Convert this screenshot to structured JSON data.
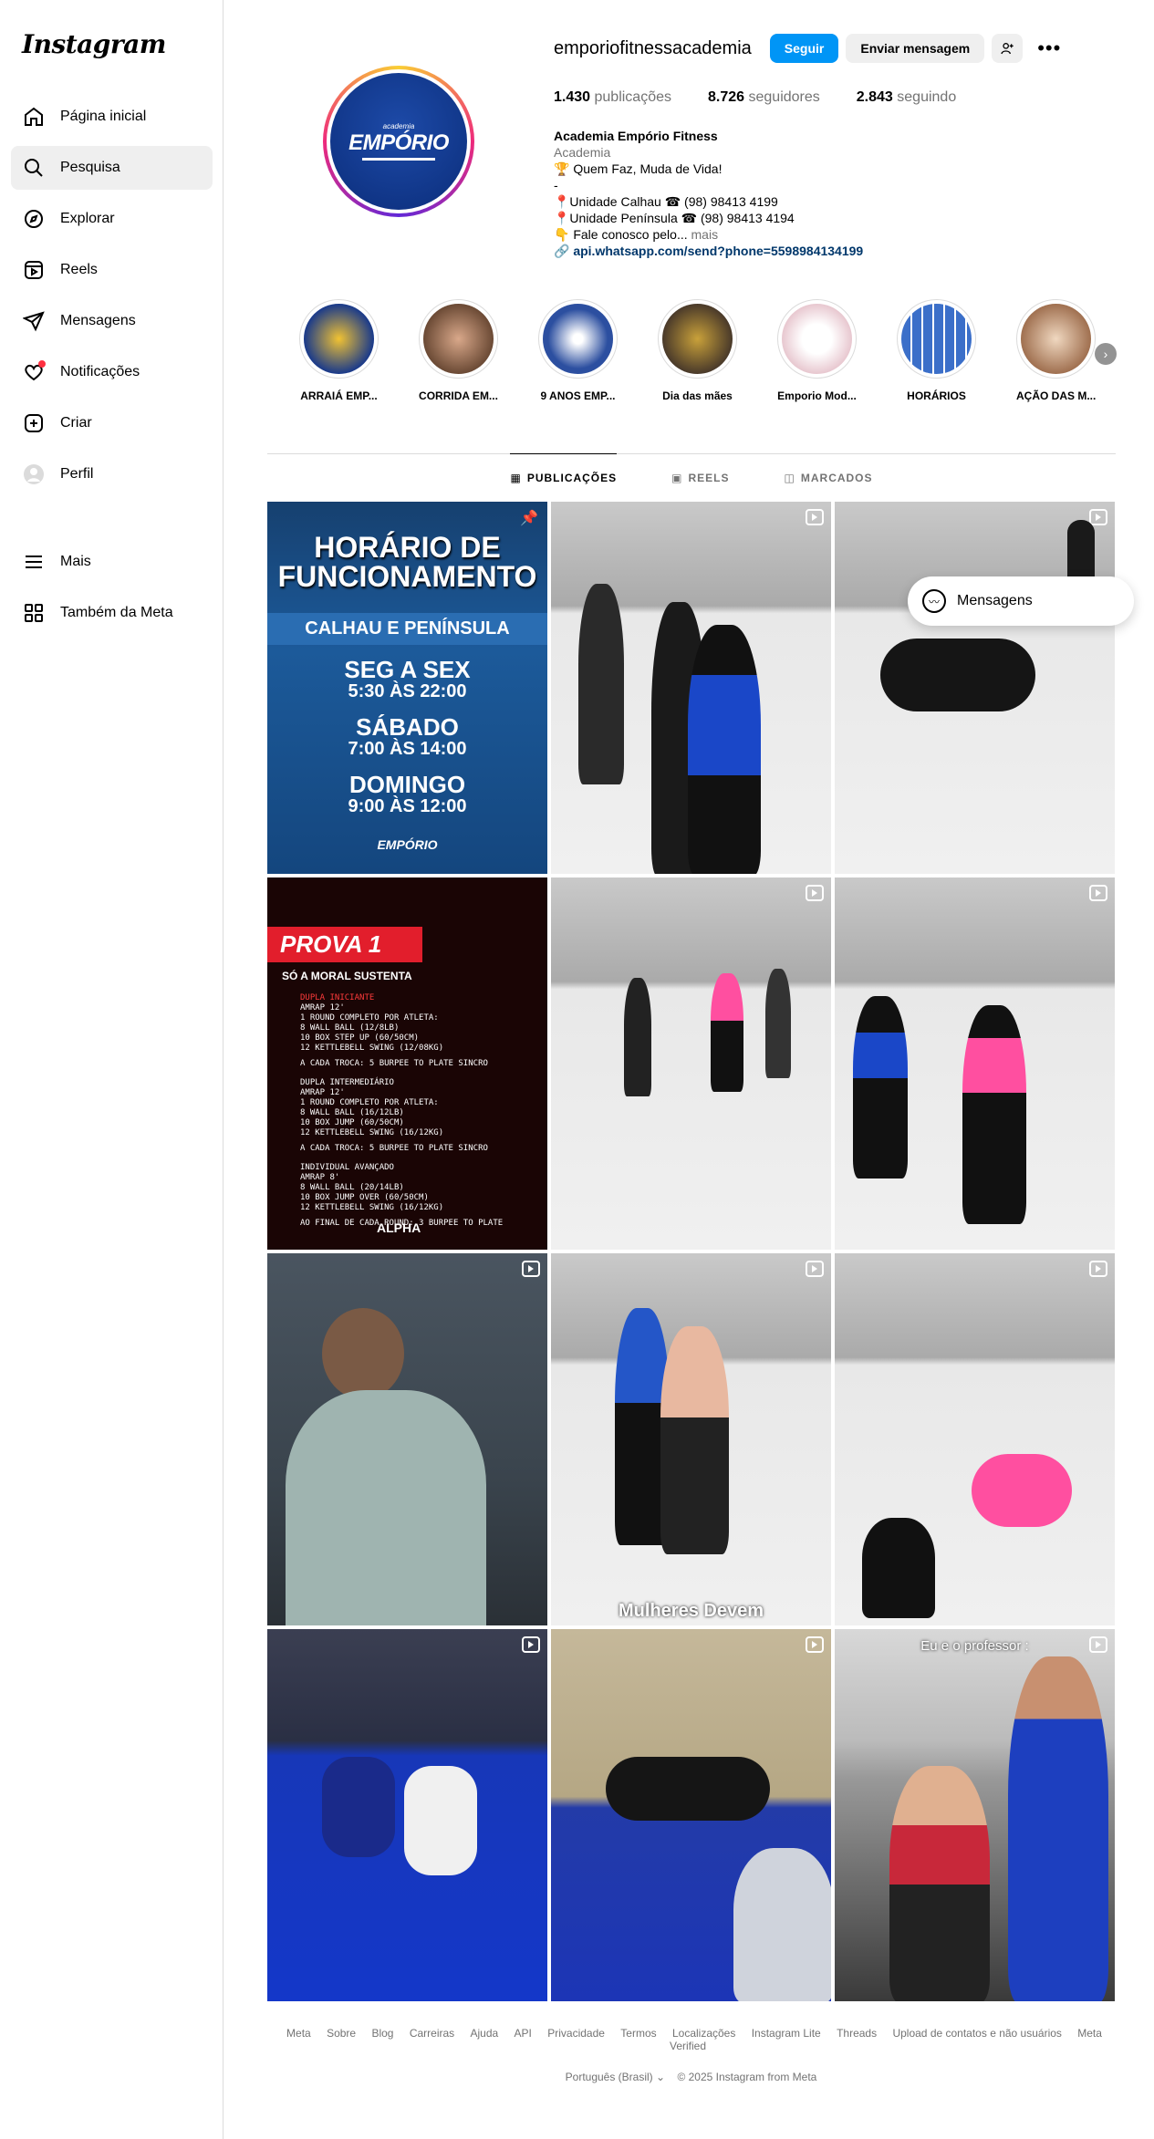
{
  "app": {
    "logo": "Instagram"
  },
  "sidebar": {
    "items": [
      {
        "label": "Página inicial",
        "icon": "home-icon"
      },
      {
        "label": "Pesquisa",
        "icon": "search-icon"
      },
      {
        "label": "Explorar",
        "icon": "compass-icon"
      },
      {
        "label": "Reels",
        "icon": "reels-icon"
      },
      {
        "label": "Mensagens",
        "icon": "send-icon"
      },
      {
        "label": "Notificações",
        "icon": "heart-icon"
      },
      {
        "label": "Criar",
        "icon": "plus-square-icon"
      },
      {
        "label": "Perfil",
        "icon": "avatar"
      }
    ],
    "bottom": [
      {
        "label": "Mais",
        "icon": "menu-icon"
      },
      {
        "label": "Também da Meta",
        "icon": "meta-grid-icon"
      }
    ]
  },
  "profile": {
    "username": "emporiofitnessacademia",
    "follow_label": "Seguir",
    "message_label": "Enviar mensagem",
    "avatar_small": "academia",
    "avatar_big": "EMPÓRIO",
    "stats": {
      "posts_count": "1.430",
      "posts_label": "publicações",
      "followers_count": "8.726",
      "followers_label": "seguidores",
      "following_count": "2.843",
      "following_label": "seguindo"
    },
    "bio": {
      "name": "Academia Empório Fitness",
      "category": "Academia",
      "line1": "🏆 Quem Faz, Muda de Vida!",
      "line2": "-",
      "line3": "📍Unidade Calhau ☎ (98) 98413 4199",
      "line4": "📍Unidade Península ☎ (98) 98413 4194",
      "line5": "👇 Fale conosco pelo...",
      "more": "mais",
      "link": "api.whatsapp.com/send?phone=5598984134199"
    }
  },
  "highlights": [
    {
      "label": "ARRAIÁ EMP...",
      "color": "#1a3a8a"
    },
    {
      "label": "CORRIDA EM...",
      "color": "#8a6a50"
    },
    {
      "label": "9 ANOS EMP...",
      "color": "#2c4fa0"
    },
    {
      "label": "Dia das mães",
      "color": "#7a6a5a"
    },
    {
      "label": "Emporio Mod...",
      "color": "#e8c8d0"
    },
    {
      "label": "HORÁRIOS",
      "color": "#3b6fc9"
    },
    {
      "label": "AÇÃO DAS M...",
      "color": "#c9a890"
    }
  ],
  "tabs": [
    {
      "label": "PUBLICAÇÕES",
      "icon": "grid-icon"
    },
    {
      "label": "REELS",
      "icon": "reels-icon"
    },
    {
      "label": "MARCADOS",
      "icon": "tag-icon"
    }
  ],
  "posts": {
    "p1": {
      "title1": "HORÁRIO DE",
      "title2": "FUNCIONAMENTO",
      "band": "CALHAU E PENÍNSULA",
      "d1": "SEG A SEX",
      "h1": "5:30 ÀS 22:00",
      "d2": "SÁBADO",
      "h2": "7:00 ÀS 14:00",
      "d3": "DOMINGO",
      "h3": "9:00 ÀS 12:00",
      "logo": "EMPÓRIO"
    },
    "p4": {
      "prova": "PROVA 1",
      "sub": "SÓ A MORAL SUSTENTA",
      "t1": "Dupla iniciante",
      "t2": "AMRAP 12'",
      "t3": "1 Round completo por atleta:",
      "t4": "8 Wall ball (12/8lb)",
      "t5": "10 Box step up (60/50cm)",
      "t6": "12 Kettlebell swing (12/08kg)",
      "t7": "A cada troca: 5 burpee to plate sincro",
      "t8": "Dupla intermediário",
      "t9": "AMRAP 12'",
      "t10": "1 Round completo por atleta:",
      "t11": "8 Wall ball (16/12lb)",
      "t12": "10 Box jump (60/50cm)",
      "t13": "12 Kettlebell swing (16/12kg)",
      "t14": "A cada troca: 5 burpee to plate sincro",
      "t15": "Individual avançado",
      "t16": "AMRAP 8'",
      "t17": "8 Wall ball (20/14lb)",
      "t18": "10 Box jump over (60/50cm)",
      "t19": "12 Kettlebell swing (16/12kg)",
      "t20": "Ao final de cada round: 3 burpee to plate",
      "alpha": "ALPHA"
    },
    "p8_caption": "Mulheres Devem",
    "p12_caption": "Eu e o professor :"
  },
  "floating": {
    "messages_label": "Mensagens"
  },
  "footer": {
    "links": [
      "Meta",
      "Sobre",
      "Blog",
      "Carreiras",
      "Ajuda",
      "API",
      "Privacidade",
      "Termos",
      "Localizações",
      "Instagram Lite",
      "Threads",
      "Upload de contatos e não usuários",
      "Meta Verified"
    ],
    "language": "Português (Brasil)",
    "copyright": "© 2025 Instagram from Meta"
  }
}
